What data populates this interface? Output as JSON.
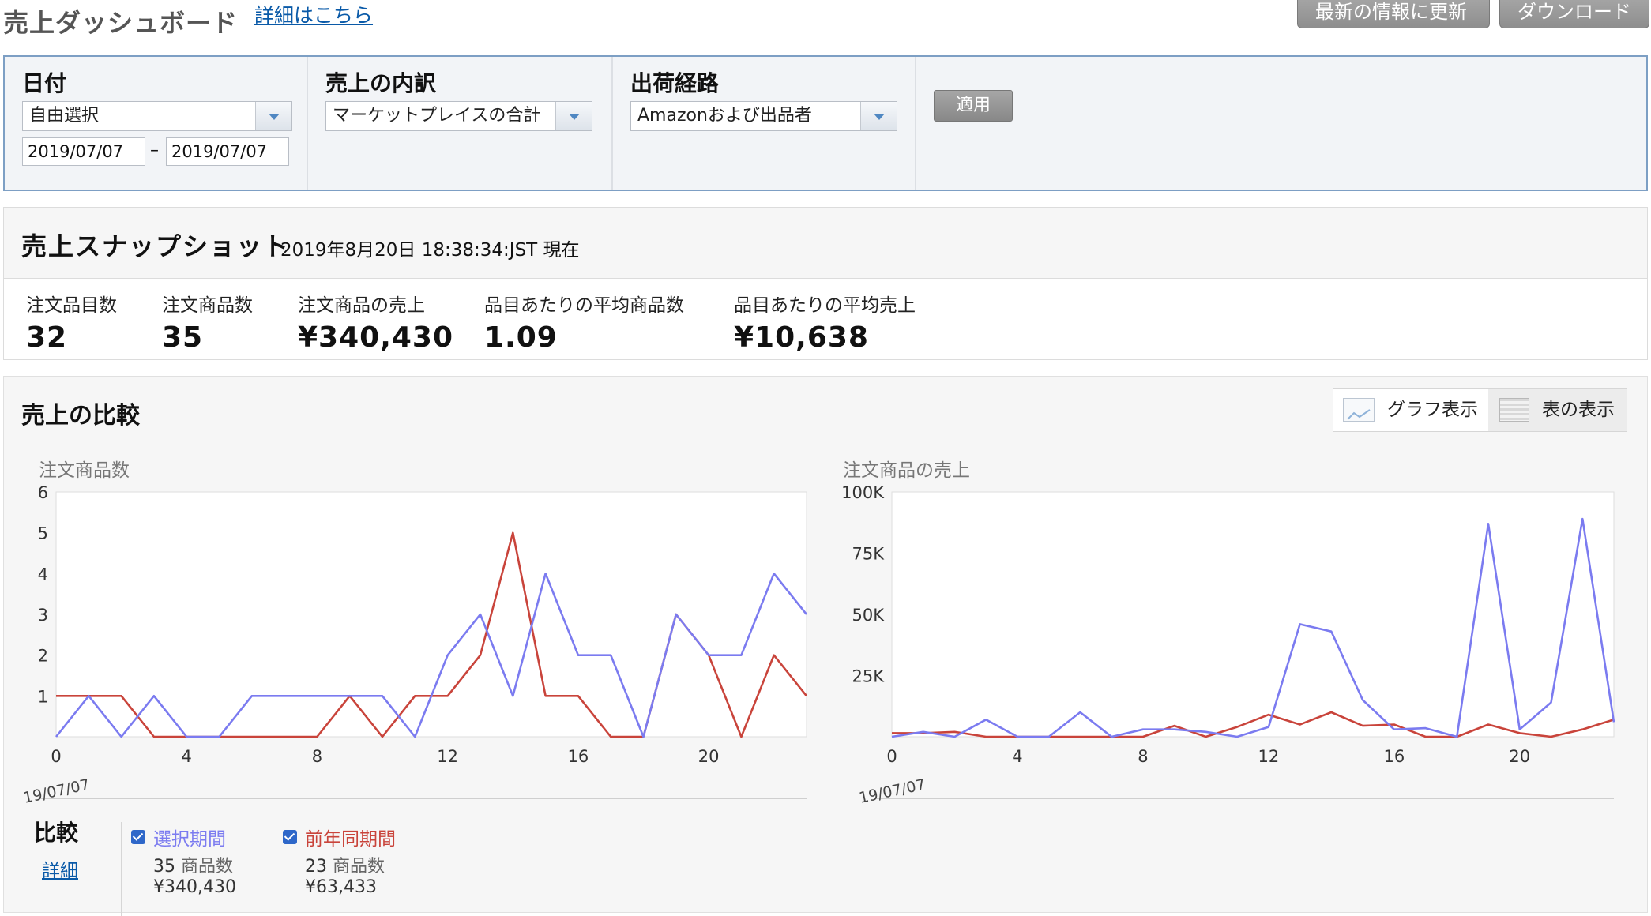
{
  "header": {
    "title": "売上ダッシュボード",
    "detail_link": "詳細はこちら",
    "refresh_button": "最新の情報に更新",
    "download_button": "ダウンロード"
  },
  "filters": {
    "date": {
      "label": "日付",
      "select_value": "自由選択",
      "start": "2019/07/07",
      "end": "2019/07/07",
      "separator": "–"
    },
    "breakdown": {
      "label": "売上の内訳",
      "select_value": "マーケットプレイスの合計"
    },
    "fulfillment": {
      "label": "出荷経路",
      "select_value": "Amazonおよび出品者"
    },
    "apply_button": "適用"
  },
  "snapshot": {
    "title": "売上スナップショット",
    "timestamp": "2019年8月20日 18:38:34:JST 現在",
    "metrics": [
      {
        "label": "注文品目数",
        "value": "32"
      },
      {
        "label": "注文商品数",
        "value": "35"
      },
      {
        "label": "注文商品の売上",
        "value": "¥340,430"
      },
      {
        "label": "品目あたりの平均商品数",
        "value": "1.09"
      },
      {
        "label": "品目あたりの平均売上",
        "value": "¥10,638"
      }
    ]
  },
  "comparison": {
    "title": "売上の比較",
    "graph_view": "グラフ表示",
    "table_view": "表の表示",
    "legend_title": "比較",
    "legend_link": "詳細",
    "series": [
      {
        "name": "選択期間",
        "color": "#7b7bf0",
        "count": "35",
        "count_unit": "商品数",
        "sales": "¥340,430"
      },
      {
        "name": "前年同期間",
        "color": "#c9443b",
        "count": "23",
        "count_unit": "商品数",
        "sales": "¥63,433"
      }
    ]
  },
  "chart_data": [
    {
      "type": "line",
      "title": "注文商品数",
      "x": [
        0,
        1,
        2,
        3,
        4,
        5,
        6,
        7,
        8,
        9,
        10,
        11,
        12,
        13,
        14,
        15,
        16,
        17,
        18,
        19,
        20,
        21,
        22,
        23
      ],
      "x_ticks": [
        "0",
        "4",
        "8",
        "12",
        "16",
        "20"
      ],
      "x_date_label": "19/07/07",
      "y_ticks": [
        "1",
        "2",
        "3",
        "4",
        "5",
        "6"
      ],
      "ylim": [
        0,
        6
      ],
      "series": [
        {
          "name": "選択期間",
          "color": "#7b7bf0",
          "values": [
            0,
            1,
            0,
            1,
            0,
            0,
            1,
            1,
            1,
            1,
            1,
            0,
            2,
            3,
            1,
            4,
            2,
            2,
            0,
            3,
            2,
            2,
            4,
            3
          ]
        },
        {
          "name": "前年同期間",
          "color": "#c9443b",
          "values": [
            1,
            1,
            1,
            0,
            0,
            0,
            0,
            0,
            0,
            1,
            0,
            1,
            1,
            2,
            5,
            1,
            1,
            0,
            0,
            3,
            2,
            0,
            2,
            1
          ]
        }
      ]
    },
    {
      "type": "line",
      "title": "注文商品の売上",
      "x": [
        0,
        1,
        2,
        3,
        4,
        5,
        6,
        7,
        8,
        9,
        10,
        11,
        12,
        13,
        14,
        15,
        16,
        17,
        18,
        19,
        20,
        21,
        22,
        23
      ],
      "x_ticks": [
        "0",
        "4",
        "8",
        "12",
        "16",
        "20"
      ],
      "x_date_label": "19/07/07",
      "y_ticks": [
        "25K",
        "50K",
        "75K",
        "100K"
      ],
      "ylim": [
        0,
        100000
      ],
      "series": [
        {
          "name": "選択期間",
          "color": "#7b7bf0",
          "values": [
            0,
            2000,
            0,
            7000,
            0,
            0,
            10000,
            0,
            3000,
            3000,
            2000,
            0,
            4000,
            46000,
            43000,
            15000,
            3000,
            3500,
            0,
            87000,
            3000,
            14000,
            89000,
            6000
          ]
        },
        {
          "name": "前年同期間",
          "color": "#c9443b",
          "values": [
            1500,
            1500,
            2000,
            0,
            0,
            0,
            0,
            0,
            0,
            4500,
            0,
            4000,
            9000,
            5000,
            10000,
            4500,
            5000,
            0,
            0,
            5000,
            1500,
            0,
            3000,
            7000
          ]
        }
      ]
    }
  ]
}
